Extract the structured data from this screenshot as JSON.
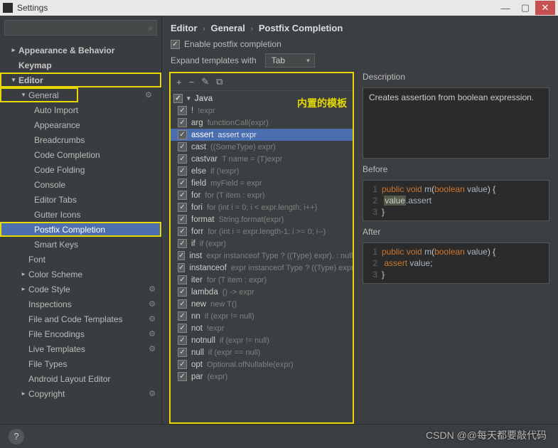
{
  "window": {
    "title": "Settings"
  },
  "search": {
    "placeholder": ""
  },
  "sidebar": {
    "appearance": "Appearance & Behavior",
    "keymap": "Keymap",
    "editor": "Editor",
    "general": "General",
    "general_children": [
      "Auto Import",
      "Appearance",
      "Breadcrumbs",
      "Code Completion",
      "Code Folding",
      "Console",
      "Editor Tabs",
      "Gutter Icons",
      "Postfix Completion",
      "Smart Keys"
    ],
    "font": "Font",
    "color_scheme": "Color Scheme",
    "code_style": "Code Style",
    "inspections": "Inspections",
    "fct": "File and Code Templates",
    "file_enc": "File Encodings",
    "live_tpl": "Live Templates",
    "file_types": "File Types",
    "ale": "Android Layout Editor",
    "copyright": "Copyright"
  },
  "breadcrumb": {
    "a": "Editor",
    "b": "General",
    "c": "Postfix Completion"
  },
  "options": {
    "enable": "Enable postfix completion",
    "expand_label": "Expand templates with",
    "expand_value": "Tab"
  },
  "templates": {
    "lang": "Java",
    "annot": "内置的模板",
    "items": [
      {
        "n": "!",
        "d": "!expr"
      },
      {
        "n": "arg",
        "d": "functionCall(expr)"
      },
      {
        "n": "assert",
        "d": "assert expr",
        "sel": true
      },
      {
        "n": "cast",
        "d": "((SomeType) expr)"
      },
      {
        "n": "castvar",
        "d": "T name = (T)expr"
      },
      {
        "n": "else",
        "d": "if (!expr)"
      },
      {
        "n": "field",
        "d": "myField = expr"
      },
      {
        "n": "for",
        "d": "for (T item : expr)"
      },
      {
        "n": "fori",
        "d": "for (int i = 0; i < expr.length; i++)"
      },
      {
        "n": "format",
        "d": "String.format(expr)"
      },
      {
        "n": "forr",
        "d": "for (int i = expr.length-1; i >= 0; i--)"
      },
      {
        "n": "if",
        "d": "if (expr)"
      },
      {
        "n": "inst",
        "d": "expr instanceof Type ? ((Type) expr). : null"
      },
      {
        "n": "instanceof",
        "d": "expr instanceof Type ? ((Type) expr)…"
      },
      {
        "n": "iter",
        "d": "for (T item : expr)"
      },
      {
        "n": "lambda",
        "d": "() -> expr"
      },
      {
        "n": "new",
        "d": "new T()"
      },
      {
        "n": "nn",
        "d": "if (expr != null)"
      },
      {
        "n": "not",
        "d": "!expr"
      },
      {
        "n": "notnull",
        "d": "if (expr != null)"
      },
      {
        "n": "null",
        "d": "if (expr == null)"
      },
      {
        "n": "opt",
        "d": "Optional.ofNullable(expr)"
      },
      {
        "n": "par",
        "d": "(expr)"
      }
    ]
  },
  "desc": {
    "label": "Description",
    "text": "Creates assertion from boolean expression."
  },
  "before": {
    "label": "Before"
  },
  "after": {
    "label": "After"
  },
  "watermark": "CSDN @@每天都要敲代码"
}
